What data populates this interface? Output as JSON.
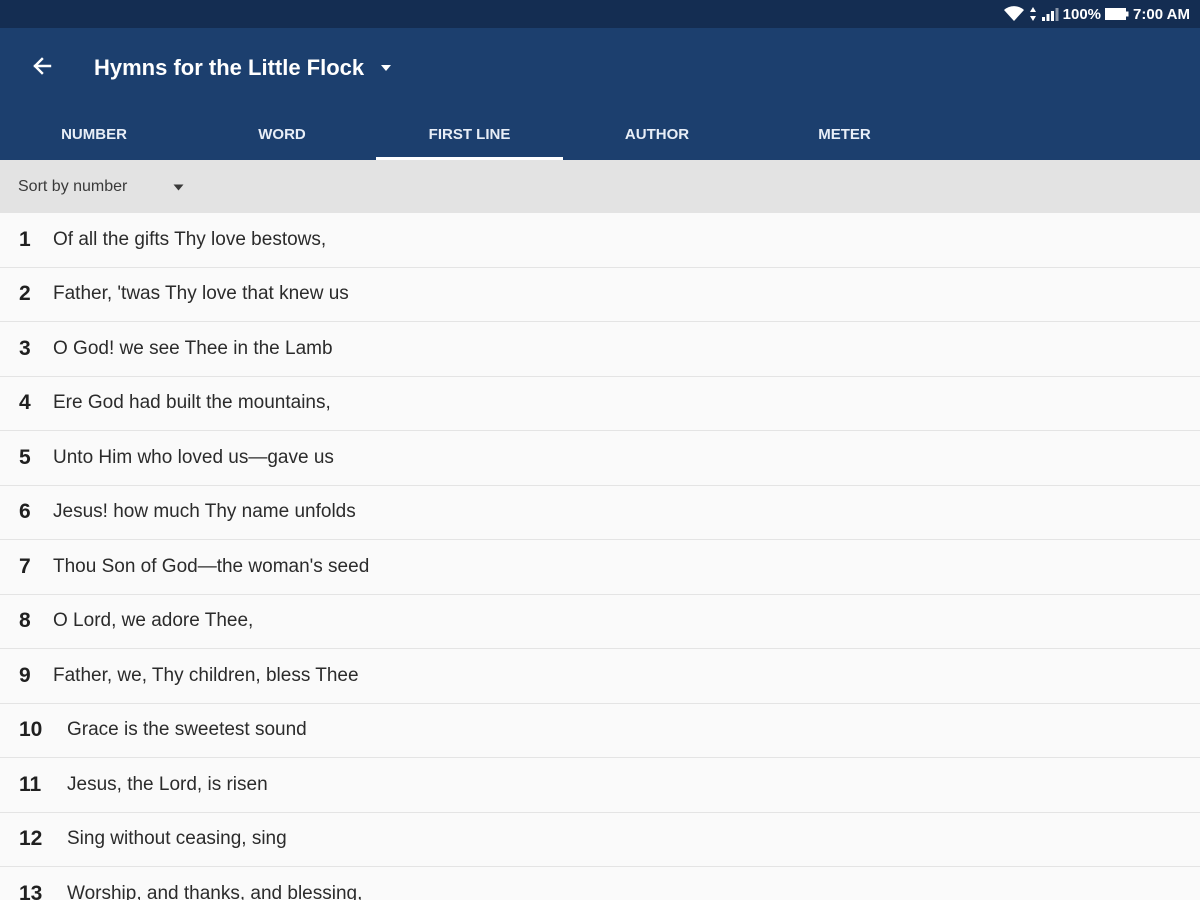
{
  "status_bar": {
    "battery_percent": "100%",
    "time": "7:00 AM"
  },
  "app_bar": {
    "title": "Hymns for the Little Flock"
  },
  "tabs": [
    {
      "label": "NUMBER",
      "active": false
    },
    {
      "label": "WORD",
      "active": false
    },
    {
      "label": "FIRST LINE",
      "active": true
    },
    {
      "label": "AUTHOR",
      "active": false
    },
    {
      "label": "METER",
      "active": false
    }
  ],
  "sort": {
    "label": "Sort by number"
  },
  "hymns": [
    {
      "number": "1",
      "first_line": "Of all the gifts Thy love bestows,"
    },
    {
      "number": "2",
      "first_line": "Father, 'twas Thy love that knew us"
    },
    {
      "number": "3",
      "first_line": "O God! we see Thee in the Lamb"
    },
    {
      "number": "4",
      "first_line": "Ere God had built the mountains,"
    },
    {
      "number": "5",
      "first_line": "Unto Him who loved us—gave us"
    },
    {
      "number": "6",
      "first_line": "Jesus! how much Thy name unfolds"
    },
    {
      "number": "7",
      "first_line": "Thou Son of God—the woman's seed"
    },
    {
      "number": "8",
      "first_line": "O Lord, we adore Thee,"
    },
    {
      "number": "9",
      "first_line": "Father, we, Thy children, bless Thee"
    },
    {
      "number": "10",
      "first_line": "Grace is the sweetest sound"
    },
    {
      "number": "11",
      "first_line": "Jesus, the Lord, is risen"
    },
    {
      "number": "12",
      "first_line": "Sing without ceasing, sing"
    },
    {
      "number": "13",
      "first_line": "Worship, and thanks, and blessing,"
    }
  ],
  "colors": {
    "app_bar": "#1c3f6e",
    "status_bar": "#142d52",
    "sort_bar": "#e3e3e3"
  }
}
